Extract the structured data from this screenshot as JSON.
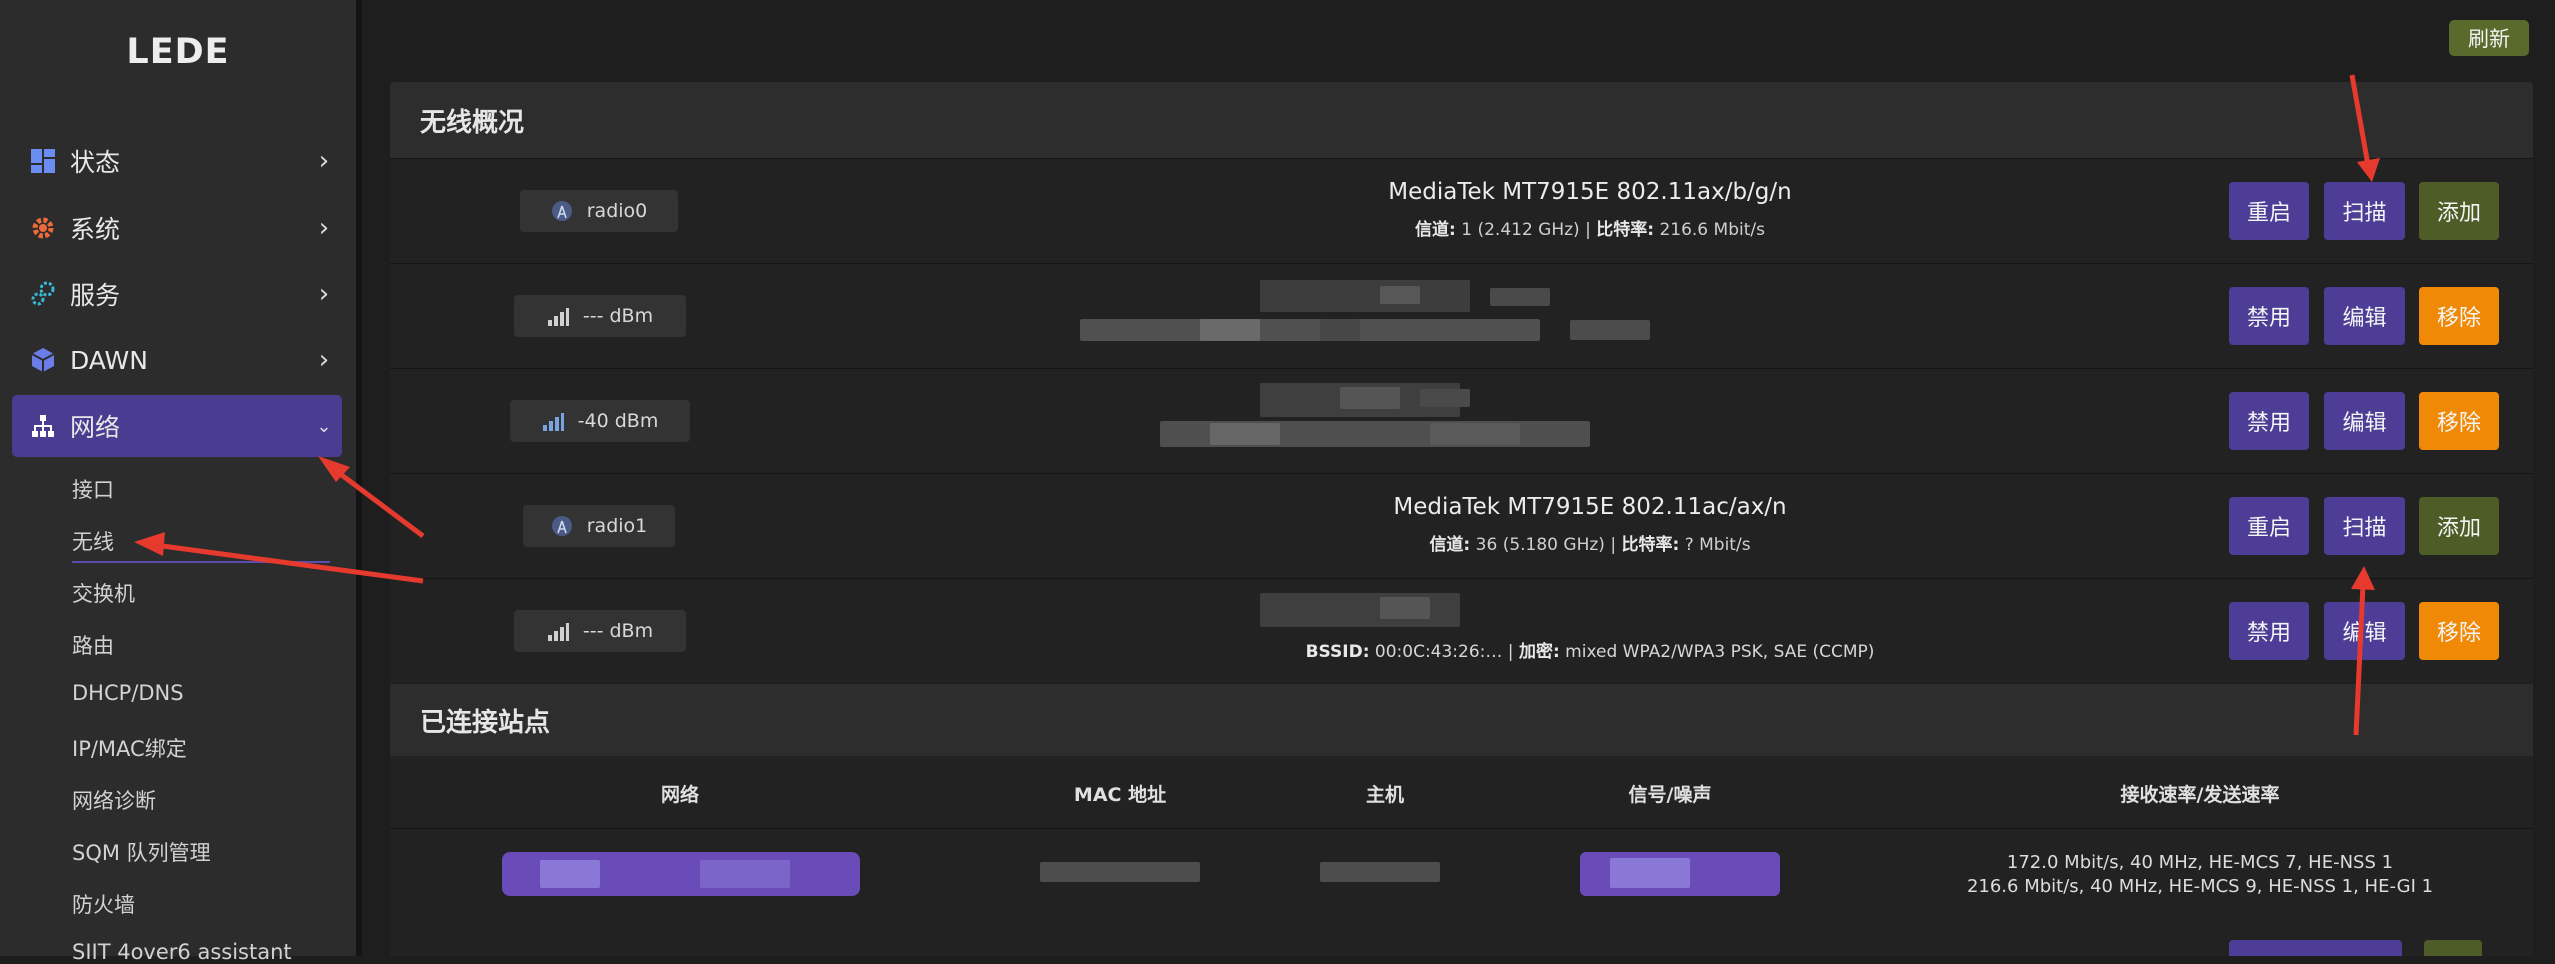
{
  "app": {
    "logo": "LEDE"
  },
  "sidebar": {
    "items": [
      {
        "label": "状态",
        "icon": "dashboard-icon"
      },
      {
        "label": "系统",
        "icon": "gear-icon"
      },
      {
        "label": "服务",
        "icon": "services-icon"
      },
      {
        "label": "DAWN",
        "icon": "cube-icon"
      },
      {
        "label": "网络",
        "icon": "network-icon",
        "active": true
      }
    ],
    "network_subitems": [
      "接口",
      "无线",
      "交换机",
      "路由",
      "DHCP/DNS",
      "IP/MAC绑定",
      "网络诊断",
      "SQM 队列管理",
      "防火墙",
      "SIIT 4over6 assistant"
    ]
  },
  "toolbar": {
    "refresh_label": "刷新"
  },
  "wireless": {
    "title": "无线概况",
    "radio0": {
      "pill": "radio0",
      "name": "MediaTek MT7915E 802.11ax/b/g/n",
      "channel_label": "信道:",
      "channel_value": "1 (2.412 GHz)",
      "sep": " | ",
      "bitrate_label": "比特率:",
      "bitrate_value": "216.6 Mbit/s",
      "btn_restart": "重启",
      "btn_scan": "扫描",
      "btn_add": "添加"
    },
    "net1": {
      "pill": "--- dBm",
      "btn_disable": "禁用",
      "btn_edit": "编辑",
      "btn_remove": "移除"
    },
    "net2": {
      "pill": "-40 dBm",
      "btn_disable": "禁用",
      "btn_edit": "编辑",
      "btn_remove": "移除"
    },
    "radio1": {
      "pill": "radio1",
      "name": "MediaTek MT7915E 802.11ac/ax/n",
      "channel_label": "信道:",
      "channel_value": "36 (5.180 GHz)",
      "sep": " | ",
      "bitrate_label": "比特率:",
      "bitrate_value": "? Mbit/s",
      "btn_restart": "重启",
      "btn_scan": "扫描",
      "btn_add": "添加"
    },
    "net3": {
      "pill": "--- dBm",
      "bssid_label": "BSSID:",
      "bssid_value": "00:0C:43:26:",
      "enc_label": "加密:",
      "enc_value": "mixed WPA2/WPA3 PSK, SAE (CCMP)",
      "btn_disable": "禁用",
      "btn_edit": "编辑",
      "btn_remove": "移除"
    }
  },
  "stations": {
    "title": "已连接站点",
    "headers": [
      "网络",
      "MAC 地址",
      "主机",
      "信号/噪声",
      "接收速率/发送速率"
    ],
    "row": {
      "rate_rx": "172.0 Mbit/s, 40 MHz, HE-MCS 7, HE-NSS 1",
      "rate_tx": "216.6 Mbit/s, 40 MHz, HE-MCS 9, HE-NSS 1, HE-GI 1"
    }
  },
  "colors": {
    "accent": "#4a3c91",
    "button_purple": "#4d3d96",
    "button_green": "#4e5d27",
    "button_orange": "#f08a06",
    "annotation": "#e63a2e"
  }
}
